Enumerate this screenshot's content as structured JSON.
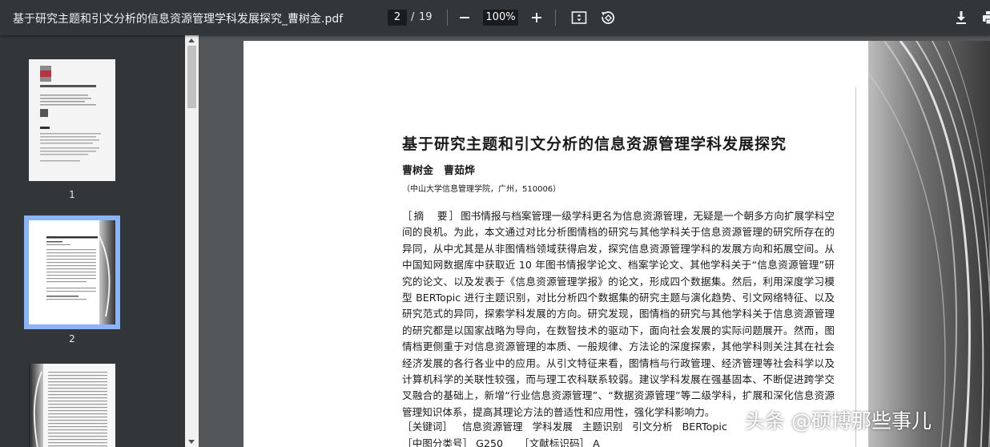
{
  "toolbar": {
    "title": "基于研究主题和引文分析的信息资源管理学科发展探究_曹树金.pdf",
    "current_page": "2",
    "page_separator": "/",
    "total_pages": "19",
    "zoom": "100%"
  },
  "sidebar": {
    "thumbnails": [
      {
        "label": "1"
      },
      {
        "label": "2"
      }
    ]
  },
  "page": {
    "title": "基于研究主题和引文分析的信息资源管理学科发展探究",
    "authors": "曹树金　曹茹烨",
    "affiliation": "（中山大学信息管理学院，广州，510006）",
    "abstract_label": "［摘　要］",
    "abstract_text": "图书情报与档案管理一级学科更名为信息资源管理，无疑是一个朝多方向扩展学科空间的良机。为此，本文通过对比分析图情档的研究与其他学科关于信息资源管理的研究所存在的异同，从中尤其是从非图情档领域获得启发，探究信息资源管理学科的发展方向和拓展空间。从中国知网数据库中获取近 10 年图书情报学论文、档案学论文、其他学科关于“信息资源管理”研究的论文、以及发表于《信息资源管理学报》的论文，形成四个数据集。然后，利用深度学习模型 BERTopic 进行主题识别，对比分析四个数据集的研究主题与演化趋势、引文网络特征、以及研究范式的异同，探索学科发展的方向。研究发现，图情档的研究与其他学科关于信息资源管理的研究都是以国家战略为导向，在数智技术的驱动下，面向社会发展的实际问题展开。然而，图情档更侧重于对信息资源管理的本质、一般规律、方法论的深度探索，其他学科则关注其在社会经济发展的各行各业中的应用。从引文特征来看，图情档与行政管理、经济管理等社会科学以及计算机科学的关联性较强，而与理工农科联系较弱。建议学科发展在强基固本、不断促进跨学交叉融合的基础上，新增“行业信息资源管理”、“数据资源管理”等二级学科，扩展和深化信息资源管理知识体系，提高其理论方法的普适性和应用性，强化学科影响力。",
    "keywords_label": "［关键词］",
    "keywords": [
      "信息资源管理",
      "学科发展",
      "主题识别",
      "引文分析",
      "BERTopic"
    ],
    "class_label": "［中图分类号］",
    "class_value": "G250",
    "doc_code_label": "［文献标识码］",
    "doc_code_value": "A"
  },
  "watermark": "头条 @硕博那些事儿"
}
